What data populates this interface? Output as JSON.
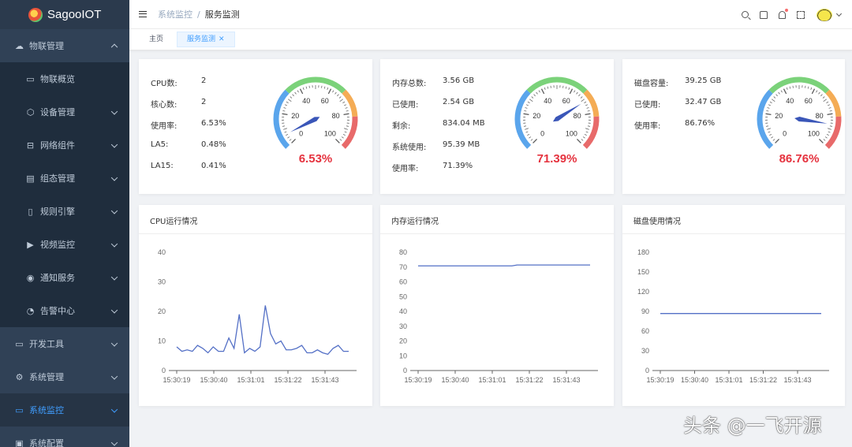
{
  "app": {
    "title": "SagooIOT"
  },
  "sidebar": {
    "items": [
      {
        "label": "物联管理",
        "icon": "cloud-icon",
        "level": "top",
        "chev": "up"
      },
      {
        "label": "物联概览",
        "icon": "monitor-icon",
        "level": "sub"
      },
      {
        "label": "设备管理",
        "icon": "cube-icon",
        "level": "sub",
        "chev": "down"
      },
      {
        "label": "网络组件",
        "icon": "network-icon",
        "level": "sub",
        "chev": "down"
      },
      {
        "label": "组态管理",
        "icon": "dashboard-icon",
        "level": "sub",
        "chev": "down"
      },
      {
        "label": "规则引擎",
        "icon": "rule-icon",
        "level": "sub",
        "chev": "down"
      },
      {
        "label": "视频监控",
        "icon": "video-icon",
        "level": "sub",
        "chev": "down"
      },
      {
        "label": "通知服务",
        "icon": "broadcast-icon",
        "level": "sub",
        "chev": "down"
      },
      {
        "label": "告警中心",
        "icon": "alarm-icon",
        "level": "sub",
        "chev": "down"
      },
      {
        "label": "开发工具",
        "icon": "laptop-icon",
        "level": "top",
        "chev": "down"
      },
      {
        "label": "系统管理",
        "icon": "gear-icon",
        "level": "top",
        "chev": "down"
      },
      {
        "label": "系统监控",
        "icon": "monitor-icon",
        "level": "top",
        "chev": "down",
        "active": true
      },
      {
        "label": "系统配置",
        "icon": "config-icon",
        "level": "top",
        "chev": "down"
      }
    ]
  },
  "header": {
    "breadcrumb": [
      "系统监控",
      "服务监测"
    ]
  },
  "tabs": [
    {
      "label": "主页",
      "active": false
    },
    {
      "label": "服务监测",
      "active": true,
      "close": "✕"
    }
  ],
  "colors": {
    "accent": "#409eff",
    "sidebar_bg": "#304156",
    "line": "#5470c6",
    "gauge_value": "#e5323e",
    "gauge_blue": "#5aa5ec",
    "gauge_green": "#7bd27a",
    "gauge_orange": "#f4ac55",
    "gauge_red": "#e86a6a"
  },
  "stats": {
    "cpu": {
      "rows": [
        {
          "k": "CPU数:",
          "v": "2"
        },
        {
          "k": "核心数:",
          "v": "2"
        },
        {
          "k": "使用率:",
          "v": "6.53%"
        },
        {
          "k": "LA5:",
          "v": "0.48%"
        },
        {
          "k": "LA15:",
          "v": "0.41%"
        }
      ],
      "gauge_value": 6.53,
      "gauge_label": "6.53%"
    },
    "mem": {
      "rows": [
        {
          "k": "内存总数:",
          "v": "3.56 GB"
        },
        {
          "k": "已使用:",
          "v": "2.54 GB"
        },
        {
          "k": "剩余:",
          "v": "834.04 MB"
        },
        {
          "k": "系统使用:",
          "v": "95.39 MB"
        },
        {
          "k": "使用率:",
          "v": "71.39%"
        }
      ],
      "gauge_value": 71.39,
      "gauge_label": "71.39%"
    },
    "disk": {
      "rows": [
        {
          "k": "磁盘容量:",
          "v": "39.25 GB"
        },
        {
          "k": "已使用:",
          "v": "32.47 GB"
        },
        {
          "k": "使用率:",
          "v": "86.76%"
        }
      ],
      "gauge_value": 86.76,
      "gauge_label": "86.76%"
    },
    "gauge_ticks": [
      "0",
      "20",
      "40",
      "60",
      "80",
      "100"
    ]
  },
  "charts": {
    "cpu_title": "CPU运行情况",
    "mem_title": "内存运行情况",
    "disk_title": "磁盘使用情况"
  },
  "chart_data": [
    {
      "type": "line",
      "title": "CPU运行情况",
      "x": [
        "15:30:19",
        "15:30:40",
        "15:31:01",
        "15:31:22",
        "15:31:43"
      ],
      "ylim": [
        0,
        40
      ],
      "yticks": [
        0,
        10,
        20,
        30,
        40
      ],
      "series": [
        {
          "values": [
            8,
            6.5,
            7,
            6.5,
            8.5,
            7.5,
            6,
            8,
            6.5,
            6.5,
            11,
            7.5,
            19,
            6,
            7.5,
            6.5,
            8,
            22,
            12.5,
            9,
            10,
            7,
            7,
            7.5,
            8.5,
            6,
            6,
            7,
            6,
            5.5,
            7.5,
            8.5,
            6.5,
            6.5
          ]
        }
      ]
    },
    {
      "type": "line",
      "title": "内存运行情况",
      "x": [
        "15:30:19",
        "15:30:40",
        "15:31:01",
        "15:31:22",
        "15:31:43"
      ],
      "ylim": [
        0,
        80
      ],
      "yticks": [
        0,
        10,
        20,
        30,
        40,
        50,
        60,
        70,
        80
      ],
      "series": [
        {
          "values": [
            70.8,
            70.8,
            70.8,
            70.8,
            70.8,
            70.8,
            70.8,
            70.8,
            70.8,
            70.8,
            70.8,
            70.8,
            70.8,
            70.8,
            70.8,
            70.8,
            70.8,
            70.8,
            70.8,
            71.4,
            71.4,
            71.4,
            71.4,
            71.4,
            71.4,
            71.4,
            71.4,
            71.4,
            71.4,
            71.4,
            71.4,
            71.4,
            71.4,
            71.4
          ]
        }
      ]
    },
    {
      "type": "line",
      "title": "磁盘使用情况",
      "x": [
        "15:30:19",
        "15:30:40",
        "15:31:01",
        "15:31:22",
        "15:31:43"
      ],
      "ylim": [
        0,
        180
      ],
      "yticks": [
        0,
        30,
        60,
        90,
        120,
        150,
        180
      ],
      "series": [
        {
          "values": [
            86.76,
            86.76,
            86.76,
            86.76,
            86.76,
            86.76,
            86.76,
            86.76,
            86.76,
            86.76,
            86.76,
            86.76,
            86.76,
            86.76,
            86.76,
            86.76,
            86.76,
            86.76,
            86.76,
            86.76,
            86.76,
            86.76,
            86.76,
            86.76,
            86.76,
            86.76,
            86.76,
            86.76,
            86.76,
            86.76,
            86.76,
            86.76,
            86.76,
            86.76
          ]
        }
      ]
    }
  ],
  "watermark": "头条 @一飞开源"
}
